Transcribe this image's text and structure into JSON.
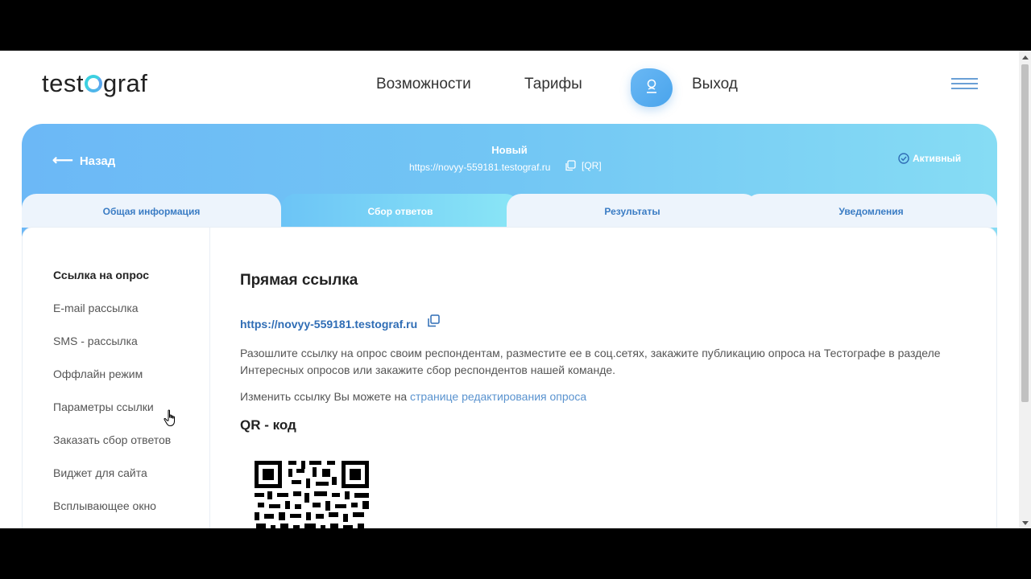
{
  "header": {
    "logo_prefix": "test",
    "logo_suffix": "graf",
    "nav": [
      "Возможности",
      "Тарифы"
    ],
    "logout": "Выход"
  },
  "hero": {
    "back": "Назад",
    "survey_name": "Новый",
    "survey_url": "https://novyy-559181.testograf.ru",
    "qr_label": "[QR]",
    "status": "Активный"
  },
  "tabs": [
    "Общая информация",
    "Сбор ответов",
    "Результаты",
    "Уведомления"
  ],
  "sidebar": {
    "items": [
      "Ссылка на опрос",
      "E-mail рассылка",
      "SMS - рассылка",
      "Оффлайн режим",
      "Параметры ссылки",
      "Заказать сбор ответов",
      "Виджет для сайта",
      "Всплывающее окно"
    ]
  },
  "main": {
    "title": "Прямая ссылка",
    "link": "https://novyy-559181.testograf.ru",
    "description": "Разошлите ссылку на опрос своим респондентам, разместите ее в соц.сетях, закажите публикацию опроса на Тестографе в разделе Интересных опросов или закажите сбор респондентов нашей команде.",
    "edit_prefix": "Изменить ссылку Вы можете на ",
    "edit_link": "странице редактирования опроса",
    "qr_title": "QR - код"
  },
  "colors": {
    "accent": "#2f6db5",
    "hero_start": "#6cb8f6",
    "hero_end": "#86dcf4"
  }
}
